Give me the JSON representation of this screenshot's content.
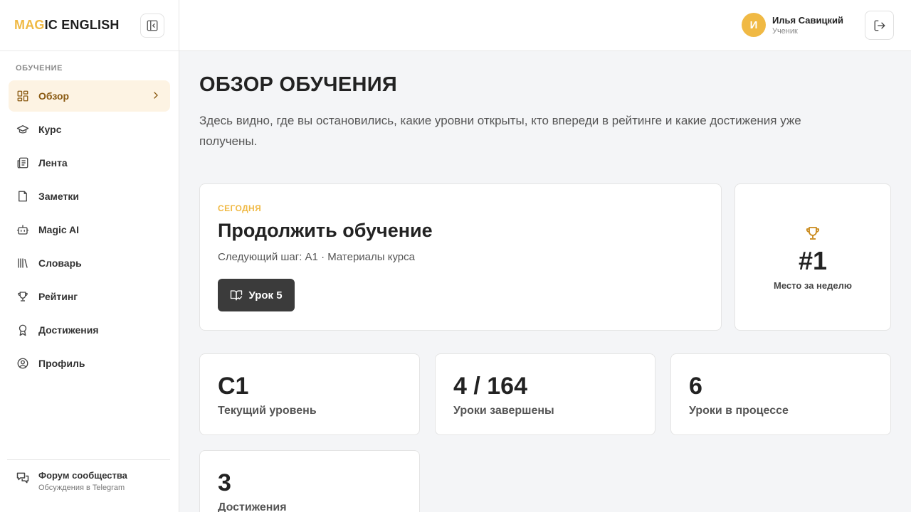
{
  "brand": {
    "part1": "MAG",
    "part2": "IC ENGLISH"
  },
  "sidebar": {
    "section": "ОБУЧЕНИЕ",
    "items": [
      {
        "label": "Обзор",
        "icon": "dashboard-icon"
      },
      {
        "label": "Курс",
        "icon": "graduation-cap-icon"
      },
      {
        "label": "Лента",
        "icon": "newspaper-icon"
      },
      {
        "label": "Заметки",
        "icon": "note-icon"
      },
      {
        "label": "Magic AI",
        "icon": "bot-icon"
      },
      {
        "label": "Словарь",
        "icon": "library-icon"
      },
      {
        "label": "Рейтинг",
        "icon": "trophy-icon"
      },
      {
        "label": "Достижения",
        "icon": "award-icon"
      },
      {
        "label": "Профиль",
        "icon": "user-circle-icon"
      }
    ],
    "forum": {
      "title": "Форум сообщества",
      "subtitle": "Обсуждения в Telegram"
    }
  },
  "header": {
    "avatar_letter": "И",
    "user_name": "Илья Савицкий",
    "user_role": "Ученик"
  },
  "main": {
    "title": "ОБЗОР ОБУЧЕНИЯ",
    "description": "Здесь видно, где вы остановились, какие уровни открыты, кто впереди в рейтинге и какие достижения уже получены.",
    "continue": {
      "eyebrow": "СЕГОДНЯ",
      "title": "Продолжить обучение",
      "next_step": "Следующий шаг: A1 · Материалы курса",
      "button": "Урок 5"
    },
    "rank": {
      "value": "#1",
      "label": "Место за неделю"
    },
    "stats": [
      {
        "value": "C1",
        "label": "Текущий уровень"
      },
      {
        "value": "4 / 164",
        "label": "Уроки завершены"
      },
      {
        "value": "6",
        "label": "Уроки в процессе"
      },
      {
        "value": "3",
        "label": "Достижения"
      }
    ]
  },
  "colors": {
    "accent": "#f0b944",
    "active_bg": "#fdf3e3",
    "active_text": "#8a5a12",
    "button_dark": "#3b3b3b"
  }
}
